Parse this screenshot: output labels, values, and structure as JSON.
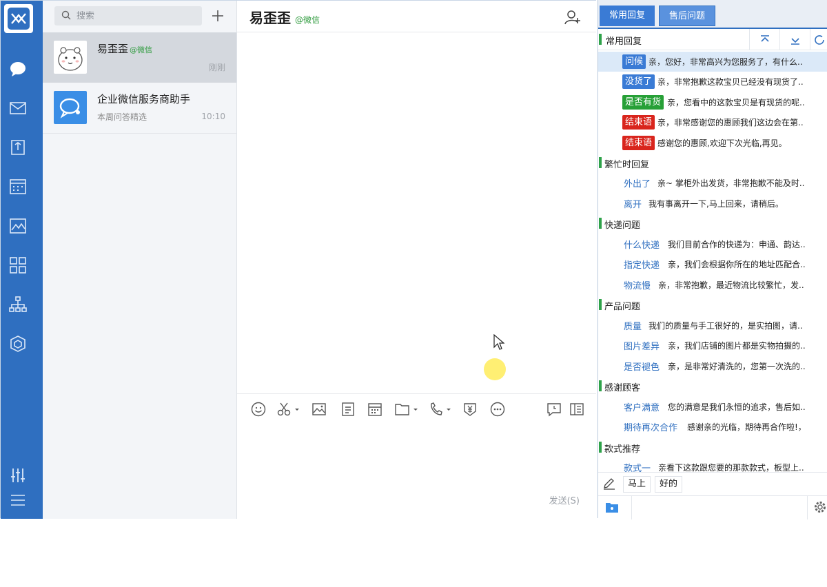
{
  "nav": {
    "icons": [
      "chat-icon",
      "mail-icon",
      "document-icon",
      "calendar-icon",
      "chart-icon",
      "apps-icon",
      "org-icon",
      "package-icon",
      "settings-sliders-icon",
      "menu-icon"
    ]
  },
  "search": {
    "placeholder": "搜索"
  },
  "conversations": [
    {
      "name": "易歪歪",
      "source": "@微信",
      "preview": "",
      "time": "刚刚"
    },
    {
      "name": "企业微信服务商助手",
      "source": "",
      "preview": "本周问答精选",
      "time": "10:10"
    }
  ],
  "chat": {
    "title": "易歪歪",
    "source": "@微信",
    "send_label": "发送(S)"
  },
  "panel": {
    "tabs": [
      "常用回复",
      "售后问题"
    ],
    "header_label": "常用回复",
    "groups": [
      {
        "title": "繁忙时回复"
      },
      {
        "title": "快递问题"
      },
      {
        "title": "产品问题"
      },
      {
        "title": "感谢顾客"
      },
      {
        "title": "款式推荐"
      }
    ],
    "replies": [
      {
        "key": "问候",
        "text": "亲，您好，非常高兴为您服务了，有什么..",
        "tag_color": "#3a7bd5"
      },
      {
        "key": "没货了",
        "text": "亲，非常抱歉这款宝贝已经没有现货了..",
        "tag_color": "#3a7bd5"
      },
      {
        "key": "是否有货",
        "text": "亲，您看中的这款宝贝是有现货的呢..",
        "tag_color": "#27a037"
      },
      {
        "key": "结束语",
        "text": "亲，非常感谢您的惠顾我们这边会在第..",
        "tag_color": "#d9251d"
      },
      {
        "key": "结束语",
        "text": "感谢您的惠顾,欢迎下次光临,再见。",
        "tag_color": "#d9251d"
      },
      {
        "key": "外出了",
        "text": "亲~ 掌柜外出发货，非常抱歉不能及时.."
      },
      {
        "key": "离开",
        "text": "我有事离开一下,马上回来，请稍后。"
      },
      {
        "key": "什么快递",
        "text": "我们目前合作的快递为：申通、韵达.."
      },
      {
        "key": "指定快递",
        "text": "亲，我们会根据你所在的地址匹配合.."
      },
      {
        "key": "物流慢",
        "text": "亲，非常抱歉，最近物流比较繁忙，发.."
      },
      {
        "key": "质量",
        "text": "我们的质量与手工很好的，是实拍图，请.."
      },
      {
        "key": "图片差异",
        "text": "亲，我们店铺的图片都是实物拍摄的.."
      },
      {
        "key": "是否褪色",
        "text": "亲，是非常好清洗的，您第一次洗的.."
      },
      {
        "key": "客户满意",
        "text": "您的满意是我们永恒的追求，售后如.."
      },
      {
        "key": "期待再次合作",
        "text": "感谢亲的光临，期待再合作啦!，"
      },
      {
        "key": "款式一",
        "text": "亲看下这款跟您要的那款款式，板型上.."
      }
    ],
    "quick": [
      "马上",
      "好的"
    ]
  },
  "colors": {
    "accent": "#2f6fc0",
    "wechat_green": "#2f9b3e"
  }
}
